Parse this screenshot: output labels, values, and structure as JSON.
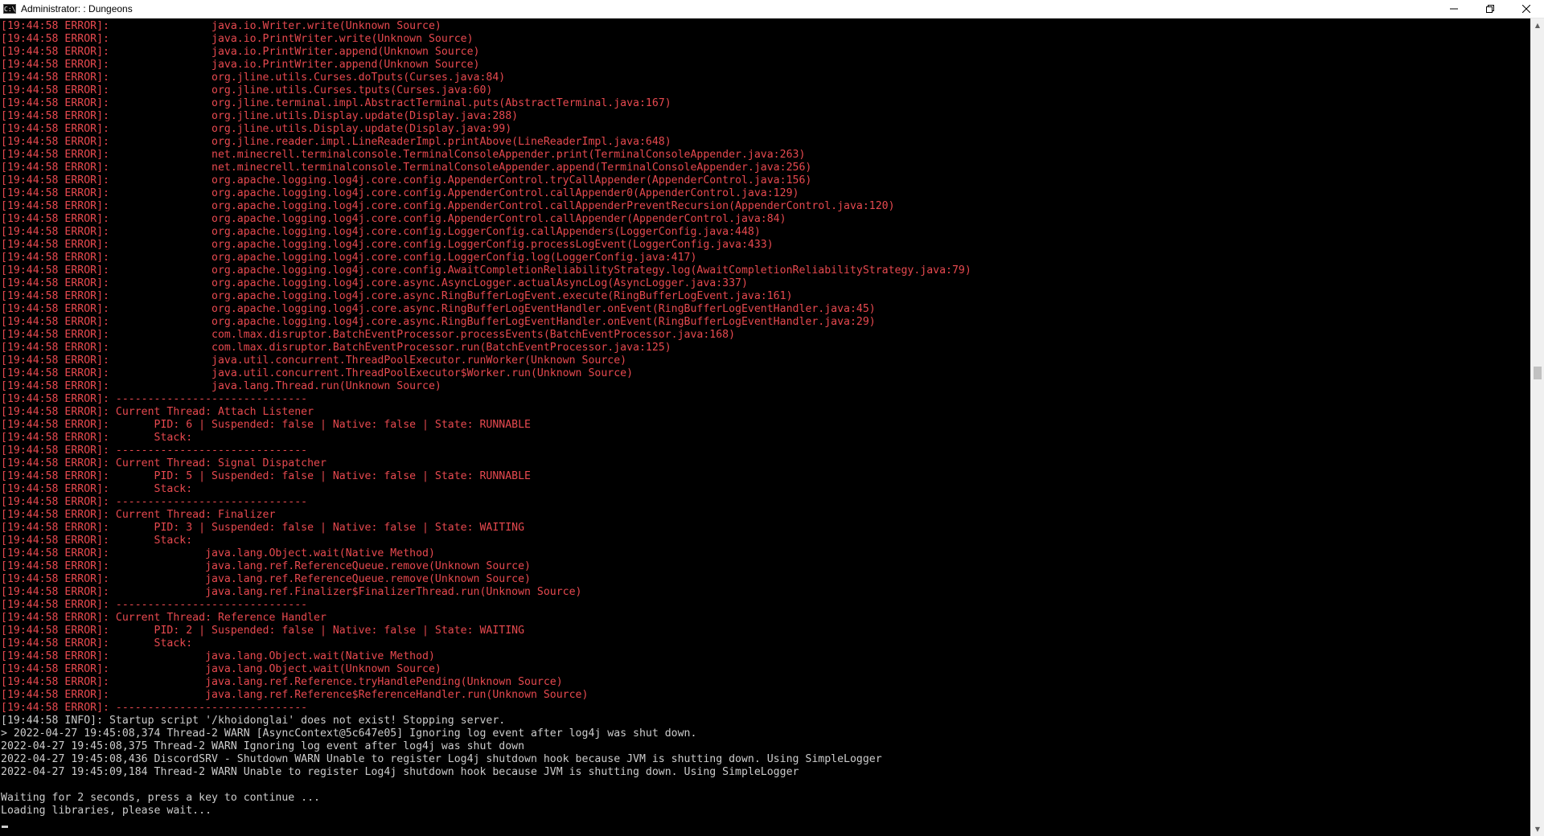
{
  "window": {
    "title": "Administrator: : Dungeons",
    "icon": "console-icon",
    "controls": [
      "minimize-icon",
      "restore-icon",
      "close-icon"
    ]
  },
  "scrollbar": {
    "position_fraction": 0.43
  },
  "colors": {
    "background": "#000000",
    "error_text": "#e7494f",
    "normal_text": "#cccccc"
  },
  "console": {
    "lines": [
      {
        "type": "error",
        "text": "[19:44:58 ERROR]:                java.io.Writer.write(Unknown Source)"
      },
      {
        "type": "error",
        "text": "[19:44:58 ERROR]:                java.io.PrintWriter.write(Unknown Source)"
      },
      {
        "type": "error",
        "text": "[19:44:58 ERROR]:                java.io.PrintWriter.append(Unknown Source)"
      },
      {
        "type": "error",
        "text": "[19:44:58 ERROR]:                java.io.PrintWriter.append(Unknown Source)"
      },
      {
        "type": "error",
        "text": "[19:44:58 ERROR]:                org.jline.utils.Curses.doTputs(Curses.java:84)"
      },
      {
        "type": "error",
        "text": "[19:44:58 ERROR]:                org.jline.utils.Curses.tputs(Curses.java:60)"
      },
      {
        "type": "error",
        "text": "[19:44:58 ERROR]:                org.jline.terminal.impl.AbstractTerminal.puts(AbstractTerminal.java:167)"
      },
      {
        "type": "error",
        "text": "[19:44:58 ERROR]:                org.jline.utils.Display.update(Display.java:288)"
      },
      {
        "type": "error",
        "text": "[19:44:58 ERROR]:                org.jline.utils.Display.update(Display.java:99)"
      },
      {
        "type": "error",
        "text": "[19:44:58 ERROR]:                org.jline.reader.impl.LineReaderImpl.printAbove(LineReaderImpl.java:648)"
      },
      {
        "type": "error",
        "text": "[19:44:58 ERROR]:                net.minecrell.terminalconsole.TerminalConsoleAppender.print(TerminalConsoleAppender.java:263)"
      },
      {
        "type": "error",
        "text": "[19:44:58 ERROR]:                net.minecrell.terminalconsole.TerminalConsoleAppender.append(TerminalConsoleAppender.java:256)"
      },
      {
        "type": "error",
        "text": "[19:44:58 ERROR]:                org.apache.logging.log4j.core.config.AppenderControl.tryCallAppender(AppenderControl.java:156)"
      },
      {
        "type": "error",
        "text": "[19:44:58 ERROR]:                org.apache.logging.log4j.core.config.AppenderControl.callAppender0(AppenderControl.java:129)"
      },
      {
        "type": "error",
        "text": "[19:44:58 ERROR]:                org.apache.logging.log4j.core.config.AppenderControl.callAppenderPreventRecursion(AppenderControl.java:120)"
      },
      {
        "type": "error",
        "text": "[19:44:58 ERROR]:                org.apache.logging.log4j.core.config.AppenderControl.callAppender(AppenderControl.java:84)"
      },
      {
        "type": "error",
        "text": "[19:44:58 ERROR]:                org.apache.logging.log4j.core.config.LoggerConfig.callAppenders(LoggerConfig.java:448)"
      },
      {
        "type": "error",
        "text": "[19:44:58 ERROR]:                org.apache.logging.log4j.core.config.LoggerConfig.processLogEvent(LoggerConfig.java:433)"
      },
      {
        "type": "error",
        "text": "[19:44:58 ERROR]:                org.apache.logging.log4j.core.config.LoggerConfig.log(LoggerConfig.java:417)"
      },
      {
        "type": "error",
        "text": "[19:44:58 ERROR]:                org.apache.logging.log4j.core.config.AwaitCompletionReliabilityStrategy.log(AwaitCompletionReliabilityStrategy.java:79)"
      },
      {
        "type": "error",
        "text": "[19:44:58 ERROR]:                org.apache.logging.log4j.core.async.AsyncLogger.actualAsyncLog(AsyncLogger.java:337)"
      },
      {
        "type": "error",
        "text": "[19:44:58 ERROR]:                org.apache.logging.log4j.core.async.RingBufferLogEvent.execute(RingBufferLogEvent.java:161)"
      },
      {
        "type": "error",
        "text": "[19:44:58 ERROR]:                org.apache.logging.log4j.core.async.RingBufferLogEventHandler.onEvent(RingBufferLogEventHandler.java:45)"
      },
      {
        "type": "error",
        "text": "[19:44:58 ERROR]:                org.apache.logging.log4j.core.async.RingBufferLogEventHandler.onEvent(RingBufferLogEventHandler.java:29)"
      },
      {
        "type": "error",
        "text": "[19:44:58 ERROR]:                com.lmax.disruptor.BatchEventProcessor.processEvents(BatchEventProcessor.java:168)"
      },
      {
        "type": "error",
        "text": "[19:44:58 ERROR]:                com.lmax.disruptor.BatchEventProcessor.run(BatchEventProcessor.java:125)"
      },
      {
        "type": "error",
        "text": "[19:44:58 ERROR]:                java.util.concurrent.ThreadPoolExecutor.runWorker(Unknown Source)"
      },
      {
        "type": "error",
        "text": "[19:44:58 ERROR]:                java.util.concurrent.ThreadPoolExecutor$Worker.run(Unknown Source)"
      },
      {
        "type": "error",
        "text": "[19:44:58 ERROR]:                java.lang.Thread.run(Unknown Source)"
      },
      {
        "type": "error",
        "text": "[19:44:58 ERROR]: ------------------------------"
      },
      {
        "type": "error",
        "text": "[19:44:58 ERROR]: Current Thread: Attach Listener"
      },
      {
        "type": "error",
        "text": "[19:44:58 ERROR]:       PID: 6 | Suspended: false | Native: false | State: RUNNABLE"
      },
      {
        "type": "error",
        "text": "[19:44:58 ERROR]:       Stack:"
      },
      {
        "type": "error",
        "text": "[19:44:58 ERROR]: ------------------------------"
      },
      {
        "type": "error",
        "text": "[19:44:58 ERROR]: Current Thread: Signal Dispatcher"
      },
      {
        "type": "error",
        "text": "[19:44:58 ERROR]:       PID: 5 | Suspended: false | Native: false | State: RUNNABLE"
      },
      {
        "type": "error",
        "text": "[19:44:58 ERROR]:       Stack:"
      },
      {
        "type": "error",
        "text": "[19:44:58 ERROR]: ------------------------------"
      },
      {
        "type": "error",
        "text": "[19:44:58 ERROR]: Current Thread: Finalizer"
      },
      {
        "type": "error",
        "text": "[19:44:58 ERROR]:       PID: 3 | Suspended: false | Native: false | State: WAITING"
      },
      {
        "type": "error",
        "text": "[19:44:58 ERROR]:       Stack:"
      },
      {
        "type": "error",
        "text": "[19:44:58 ERROR]:               java.lang.Object.wait(Native Method)"
      },
      {
        "type": "error",
        "text": "[19:44:58 ERROR]:               java.lang.ref.ReferenceQueue.remove(Unknown Source)"
      },
      {
        "type": "error",
        "text": "[19:44:58 ERROR]:               java.lang.ref.ReferenceQueue.remove(Unknown Source)"
      },
      {
        "type": "error",
        "text": "[19:44:58 ERROR]:               java.lang.ref.Finalizer$FinalizerThread.run(Unknown Source)"
      },
      {
        "type": "error",
        "text": "[19:44:58 ERROR]: ------------------------------"
      },
      {
        "type": "error",
        "text": "[19:44:58 ERROR]: Current Thread: Reference Handler"
      },
      {
        "type": "error",
        "text": "[19:44:58 ERROR]:       PID: 2 | Suspended: false | Native: false | State: WAITING"
      },
      {
        "type": "error",
        "text": "[19:44:58 ERROR]:       Stack:"
      },
      {
        "type": "error",
        "text": "[19:44:58 ERROR]:               java.lang.Object.wait(Native Method)"
      },
      {
        "type": "error",
        "text": "[19:44:58 ERROR]:               java.lang.Object.wait(Unknown Source)"
      },
      {
        "type": "error",
        "text": "[19:44:58 ERROR]:               java.lang.ref.Reference.tryHandlePending(Unknown Source)"
      },
      {
        "type": "error",
        "text": "[19:44:58 ERROR]:               java.lang.ref.Reference$ReferenceHandler.run(Unknown Source)"
      },
      {
        "type": "error",
        "text": "[19:44:58 ERROR]: ------------------------------"
      },
      {
        "type": "info",
        "text": "[19:44:58 INFO]: Startup script '/khoidonglai' does not exist! Stopping server."
      },
      {
        "type": "plain",
        "text": "> 2022-04-27 19:45:08,374 Thread-2 WARN [AsyncContext@5c647e05] Ignoring log event after log4j was shut down."
      },
      {
        "type": "plain",
        "text": "2022-04-27 19:45:08,375 Thread-2 WARN Ignoring log event after log4j was shut down"
      },
      {
        "type": "plain",
        "text": "2022-04-27 19:45:08,436 DiscordSRV - Shutdown WARN Unable to register Log4j shutdown hook because JVM is shutting down. Using SimpleLogger"
      },
      {
        "type": "plain",
        "text": "2022-04-27 19:45:09,184 Thread-2 WARN Unable to register Log4j shutdown hook because JVM is shutting down. Using SimpleLogger"
      },
      {
        "type": "plain",
        "text": ""
      },
      {
        "type": "plain",
        "text": "Waiting for 2 seconds, press a key to continue ..."
      },
      {
        "type": "plain",
        "text": "Loading libraries, please wait..."
      }
    ]
  }
}
